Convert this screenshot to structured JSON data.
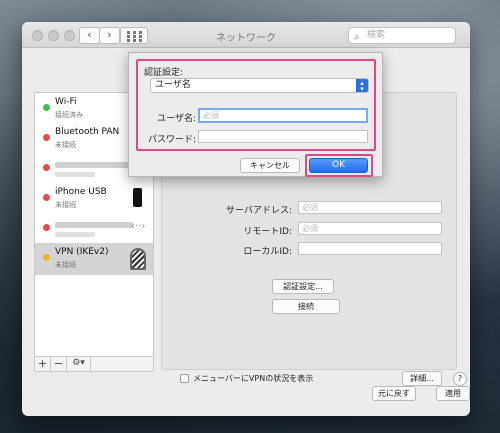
{
  "window": {
    "title": "ネットワーク",
    "search_placeholder": "検索",
    "nav_back": "‹",
    "nav_forward": "›"
  },
  "sidebar": {
    "items": [
      {
        "name": "Wi-Fi",
        "status": "接続済み",
        "dot": "#3cbf4a"
      },
      {
        "name": "Bluetooth PAN",
        "status": "未接続",
        "dot": "#e84a4a"
      },
      {
        "name": "",
        "status": "",
        "dot": "#e84a4a"
      },
      {
        "name": "iPhone USB",
        "status": "未接続",
        "dot": "#e84a4a"
      },
      {
        "name": "",
        "status": "",
        "dot": "#e84a4a"
      },
      {
        "name": "VPN (IKEv2)",
        "status": "未接続",
        "dot": "#f0b52c"
      }
    ],
    "footer": {
      "add": "+",
      "remove": "−",
      "gear": "⚙︎▾"
    }
  },
  "panel": {
    "server_label": "サーバアドレス:",
    "server_placeholder": "必須",
    "remote_label": "リモートID:",
    "remote_placeholder": "必須",
    "local_label": "ローカルID:",
    "auth_button": "認証設定...",
    "connect_button": "接続",
    "menubar_checkbox": "メニューバーにVPNの状況を表示",
    "details_button": "詳細...",
    "help": "?"
  },
  "footer": {
    "revert": "元に戻す",
    "apply": "適用"
  },
  "sheet": {
    "title": "認証設定:",
    "method": "ユーザ名",
    "username_label": "ユーザ名:",
    "username_placeholder": "必須",
    "password_label": "パスワード:",
    "password_value": "",
    "cancel": "キャンセル",
    "ok": "OK"
  },
  "colors": {
    "highlight": "#e0468a",
    "accent": "#2b6fe0"
  }
}
